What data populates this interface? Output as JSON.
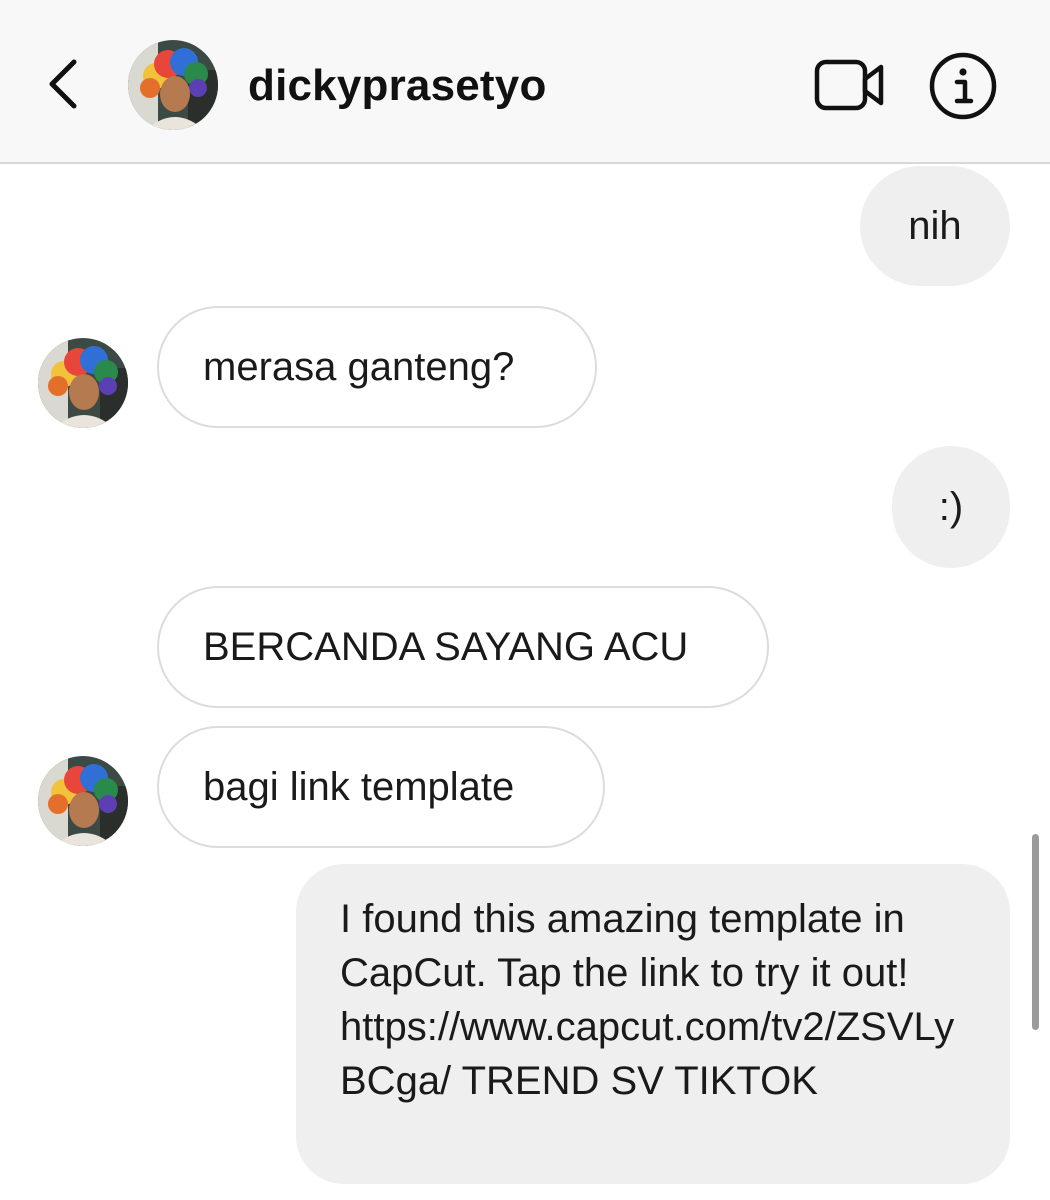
{
  "header": {
    "username": "dickyprasetyo"
  },
  "messages": [
    {
      "direction": "outgoing",
      "text": "nih"
    },
    {
      "direction": "incoming",
      "text": "merasa ganteng?"
    },
    {
      "direction": "outgoing",
      "text": ":)"
    },
    {
      "direction": "incoming",
      "text": "BERCANDA SAYANG ACU"
    },
    {
      "direction": "incoming",
      "text": "bagi link template"
    },
    {
      "direction": "outgoing",
      "text": "I found this amazing template in CapCut. Tap the link to try it out! https://www.capcut.com/tv2/ZSVLyBCga/ TREND SV TIKTOK"
    }
  ],
  "icons": {
    "back": "chevron-left-icon",
    "video": "video-camera-icon",
    "info": "info-icon"
  },
  "colors": {
    "header_bg": "#f8f8f8",
    "outgoing_bubble": "#efefef",
    "incoming_border": "#dcdcdc",
    "text": "#1a1a1a"
  }
}
